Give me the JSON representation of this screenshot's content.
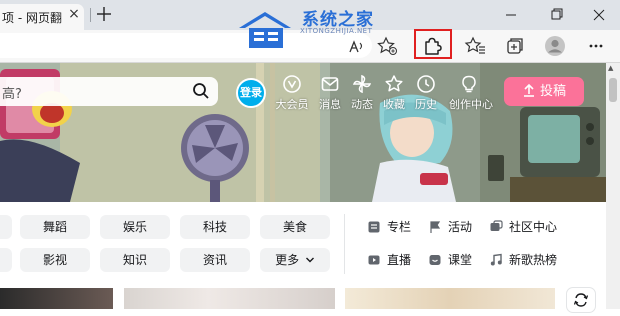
{
  "browser": {
    "tab_title": "项 - 网页翻",
    "tab_close": "×",
    "colors": {
      "highlight": "#e02020",
      "tabbar": "#dfe3e8"
    }
  },
  "watermark": {
    "title": "系统之家",
    "subtitle": "XITONGZHIJIA.NET"
  },
  "site": {
    "search_placeholder": "高?",
    "login_label": "登录",
    "nav": [
      {
        "label": "大会员",
        "icon": "vip-icon"
      },
      {
        "label": "消息",
        "icon": "message-icon"
      },
      {
        "label": "动态",
        "icon": "pinwheel-icon"
      },
      {
        "label": "收藏",
        "icon": "star-icon"
      },
      {
        "label": "历史",
        "icon": "clock-icon"
      },
      {
        "label": "创作中心",
        "icon": "bulb-icon"
      }
    ],
    "upload_label": "投稿",
    "categories_row1": [
      "舞蹈",
      "娱乐",
      "科技",
      "美食"
    ],
    "categories_row2": [
      "影视",
      "知识",
      "资讯",
      "更多"
    ],
    "side_links": [
      {
        "label": "专栏",
        "icon": "article-icon"
      },
      {
        "label": "活动",
        "icon": "flag-icon"
      },
      {
        "label": "社区中心",
        "icon": "community-icon"
      },
      {
        "label": "直播",
        "icon": "live-icon"
      },
      {
        "label": "课堂",
        "icon": "class-icon"
      },
      {
        "label": "新歌热榜",
        "icon": "music-icon"
      }
    ],
    "colors": {
      "accent": "#00aeec",
      "upload": "#fb7299"
    }
  }
}
